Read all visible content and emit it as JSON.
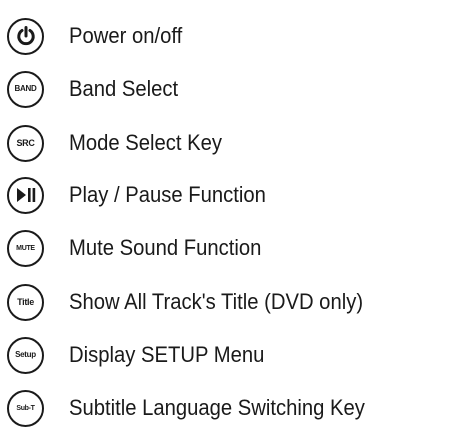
{
  "items": [
    {
      "icon": "power-icon",
      "button_text": "",
      "label": "Power on/off"
    },
    {
      "icon": "band-button-icon",
      "button_text": "BAND",
      "label": "Band Select"
    },
    {
      "icon": "src-button-icon",
      "button_text": "SRC",
      "label": "Mode Select Key"
    },
    {
      "icon": "play-pause-icon",
      "button_text": "",
      "label": "Play / Pause Function"
    },
    {
      "icon": "mute-button-icon",
      "button_text": "MUTE",
      "label": "Mute Sound Function"
    },
    {
      "icon": "title-button-icon",
      "button_text": "Title",
      "label": "Show All Track's Title (DVD only)"
    },
    {
      "icon": "setup-button-icon",
      "button_text": "Setup",
      "label": "Display SETUP Menu"
    },
    {
      "icon": "subtitle-button-icon",
      "button_text": "Sub-T",
      "label": "Subtitle Language Switching Key"
    }
  ],
  "colors": {
    "ink": "#1a1a1a",
    "background": "#ffffff"
  }
}
